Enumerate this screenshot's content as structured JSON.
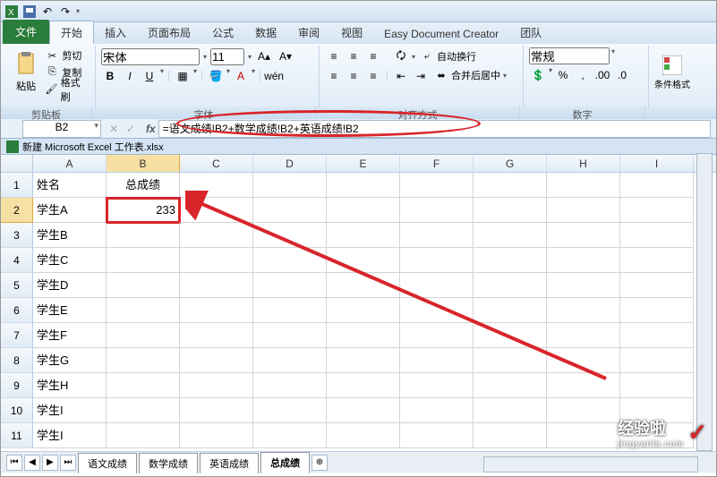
{
  "qat": {
    "save": "save-icon",
    "undo": "undo-icon",
    "redo": "redo-icon"
  },
  "tabs": {
    "file": "文件",
    "home": "开始",
    "insert": "插入",
    "layout": "页面布局",
    "formulas": "公式",
    "data": "数据",
    "review": "审阅",
    "view": "视图",
    "edc": "Easy Document Creator",
    "team": "团队"
  },
  "ribbon": {
    "clipboard": {
      "paste": "粘贴",
      "cut": "剪切",
      "copy": "复制",
      "format_painter": "格式刷",
      "label": "剪贴板"
    },
    "font": {
      "name": "宋体",
      "size": "11",
      "bold": "B",
      "italic": "I",
      "underline": "U",
      "label": "字体"
    },
    "align": {
      "wrap": "自动换行",
      "merge": "合并后居中",
      "label": "对齐方式"
    },
    "number": {
      "format": "常规",
      "label": "数字"
    },
    "styles": {
      "cond": "条件格式",
      "label": ""
    }
  },
  "namebox": "B2",
  "formula": "=语文成绩!B2+数学成绩!B2+英语成绩!B2",
  "workbook": "新建 Microsoft Excel 工作表.xlsx",
  "columns": [
    "A",
    "B",
    "C",
    "D",
    "E",
    "F",
    "G",
    "H",
    "I"
  ],
  "header_row": {
    "A": "姓名",
    "B": "总成绩"
  },
  "data_rows": [
    {
      "n": "1",
      "A": "姓名",
      "B": "总成绩"
    },
    {
      "n": "2",
      "A": "学生A",
      "B": "233"
    },
    {
      "n": "3",
      "A": "学生B",
      "B": ""
    },
    {
      "n": "4",
      "A": "学生C",
      "B": ""
    },
    {
      "n": "5",
      "A": "学生D",
      "B": ""
    },
    {
      "n": "6",
      "A": "学生E",
      "B": ""
    },
    {
      "n": "7",
      "A": "学生F",
      "B": ""
    },
    {
      "n": "8",
      "A": "学生G",
      "B": ""
    },
    {
      "n": "9",
      "A": "学生H",
      "B": ""
    },
    {
      "n": "10",
      "A": "学生I",
      "B": ""
    },
    {
      "n": "11",
      "A": "学生I",
      "B": ""
    }
  ],
  "sheets": [
    "语文成绩",
    "数学成绩",
    "英语成绩",
    "总成绩"
  ],
  "watermark": {
    "main": "经验啦",
    "sub": "jingyanla.com"
  }
}
